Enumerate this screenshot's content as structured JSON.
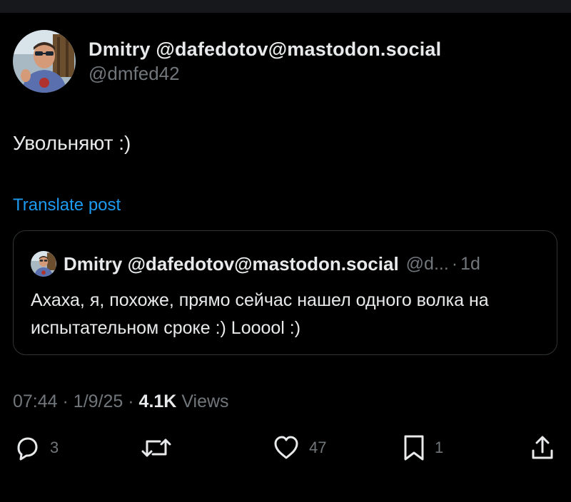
{
  "post": {
    "author_name": "Dmitry @dafedotov@mastodon.social",
    "author_handle": "@dmfed42",
    "text": "Увольняют :)",
    "translate_label": "Translate post"
  },
  "quote": {
    "author_name": "Dmitry @dafedotov@mastodon.social",
    "author_handle": "@d...",
    "separator": "·",
    "age": "1d",
    "text": "Ахаха, я, похоже, прямо сейчас нашел одного волка на испытательном сроке :) Looool :)"
  },
  "meta": {
    "time": "07:44",
    "separator": "·",
    "date": "1/9/25",
    "views_count": "4.1K",
    "views_label": "Views"
  },
  "actions": {
    "replies": "3",
    "likes": "47",
    "bookmarks": "1"
  },
  "colors": {
    "background": "#000000",
    "text": "#e7e9ea",
    "secondary": "#71767b",
    "link": "#1d9bf0",
    "border": "#2f3336"
  },
  "icons": {
    "reply": "speech-bubble-icon",
    "repost": "repost-arrows-icon",
    "like": "heart-icon",
    "bookmark": "bookmark-icon",
    "share": "share-upload-icon"
  }
}
